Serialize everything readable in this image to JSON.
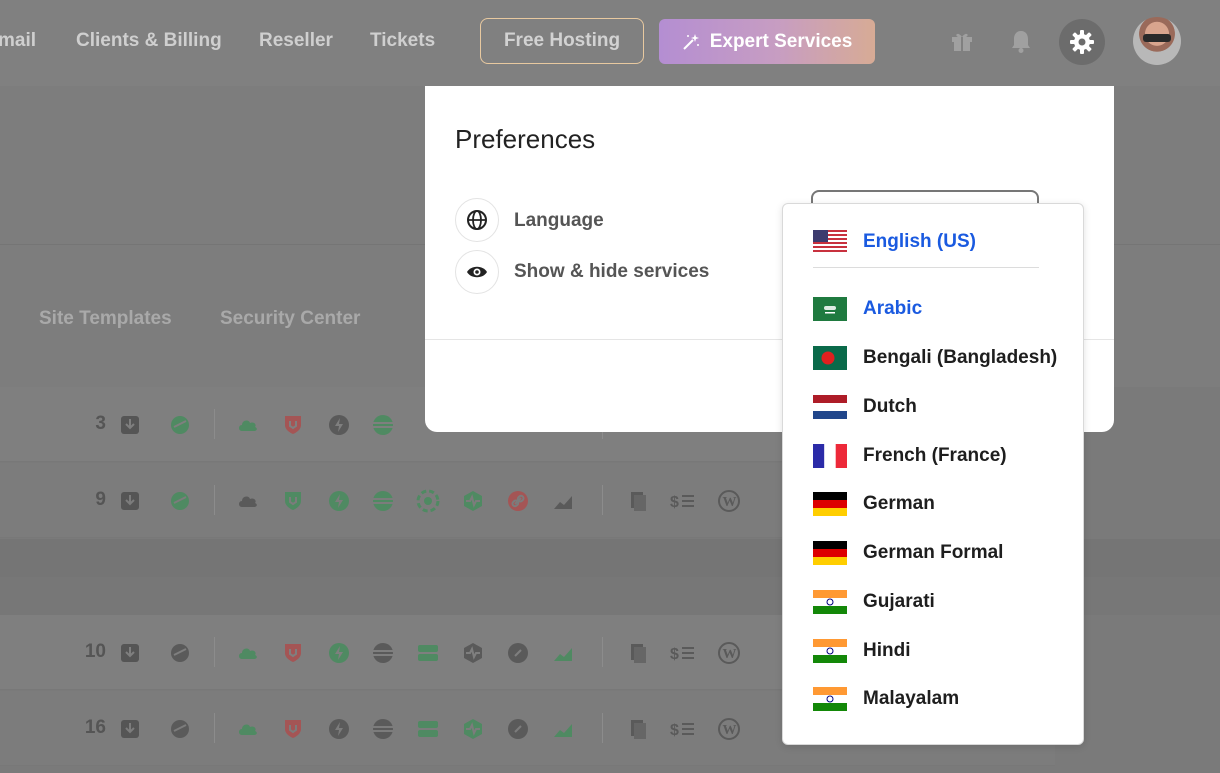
{
  "nav": {
    "links": [
      "mail",
      "Clients & Billing",
      "Reseller",
      "Tickets"
    ],
    "free_hosting": "Free Hosting",
    "expert_services": "Expert Services"
  },
  "subtabs": [
    "Site Templates",
    "Security Center"
  ],
  "rows": [
    {
      "count": "3"
    },
    {
      "count": "9"
    },
    {
      "count": "10"
    },
    {
      "count": "16"
    }
  ],
  "preferences": {
    "title": "Preferences",
    "items": [
      {
        "label": "Language",
        "icon": "globe-icon"
      },
      {
        "label": "Show & hide services",
        "icon": "eye-icon"
      }
    ]
  },
  "language_dropdown": {
    "selected": "English (US)",
    "options": [
      {
        "name": "Arabic",
        "flag": "saudi-arabia"
      },
      {
        "name": "Bengali (Bangladesh)",
        "flag": "bangladesh"
      },
      {
        "name": "Dutch",
        "flag": "netherlands"
      },
      {
        "name": "French (France)",
        "flag": "france"
      },
      {
        "name": "German",
        "flag": "germany"
      },
      {
        "name": "German Formal",
        "flag": "germany"
      },
      {
        "name": "Gujarati",
        "flag": "india"
      },
      {
        "name": "Hindi",
        "flag": "india"
      },
      {
        "name": "Malayalam",
        "flag": "india"
      }
    ],
    "hovered": "Arabic"
  },
  "colors": {
    "accent_blue": "#1a5ae0",
    "icon_green": "#5dbb7a",
    "icon_red": "#e06a6a",
    "icon_gray": "#8a8a8a"
  }
}
